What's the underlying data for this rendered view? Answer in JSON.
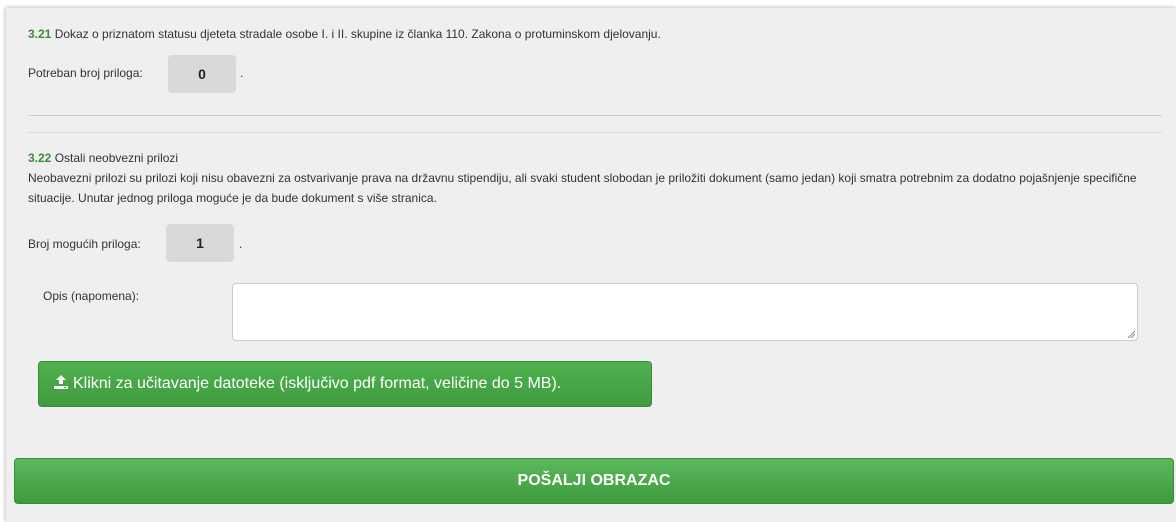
{
  "section_321": {
    "number": "3.21",
    "title": "Dokaz o priznatom statusu djeteta stradale osobe I. i II. skupine iz članka 110. Zakona o protuminskom djelovanju.",
    "count_label": "Potreban broj priloga:",
    "count_value": "0",
    "trailing": "."
  },
  "section_322": {
    "number": "3.22",
    "title": "Ostali neobvezni prilozi",
    "description": "Neobavezni prilozi su prilozi koji nisu obavezni za ostvarivanje prava na državnu stipendiju, ali svaki student slobodan je priložiti dokument (samo jedan) koji smatra potrebnim za dodatno pojašnjenje specifične situacije. Unutar jednog priloga moguće je da bude dokument s više stranica.",
    "count_label": "Broj mogućih priloga:",
    "count_value": "1",
    "trailing": ".",
    "note_label": "Opis (napomena):",
    "note_value": "",
    "upload_label": "Klikni za učitavanje datoteke (isključivo pdf format, veličine do 5 MB).",
    "upload_icon": "upload-icon"
  },
  "submit_label": "POŠALJI OBRAZAC",
  "colors": {
    "panel_bg": "#efefef",
    "accent_green": "#3c8b3c",
    "button_green": "#4cae4c",
    "count_box_bg": "#d9d9d9"
  }
}
